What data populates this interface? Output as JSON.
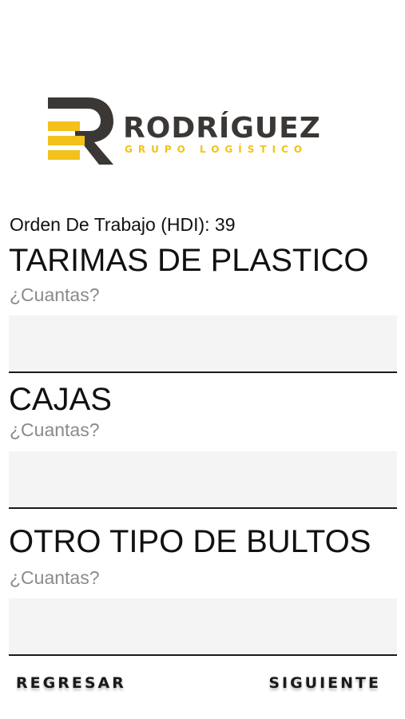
{
  "brand": {
    "name": "RODRÍGUEZ",
    "tagline": "GRUPO LOGÍSTICO",
    "colors": {
      "dark": "#3a3735",
      "accent": "#f2c21b"
    }
  },
  "order": {
    "text": "Orden De Trabajo (HDI): 39"
  },
  "sections": [
    {
      "title": "TARIMAS DE PLASTICO",
      "hint": "¿Cuantas?",
      "value": ""
    },
    {
      "title": "CAJAS",
      "hint": "¿Cuantas?",
      "value": ""
    },
    {
      "title": "OTRO TIPO DE BULTOS",
      "hint": "¿Cuantas?",
      "value": ""
    }
  ],
  "footer": {
    "back_label": "REGRESAR",
    "next_label": "SIGUIENTE"
  }
}
